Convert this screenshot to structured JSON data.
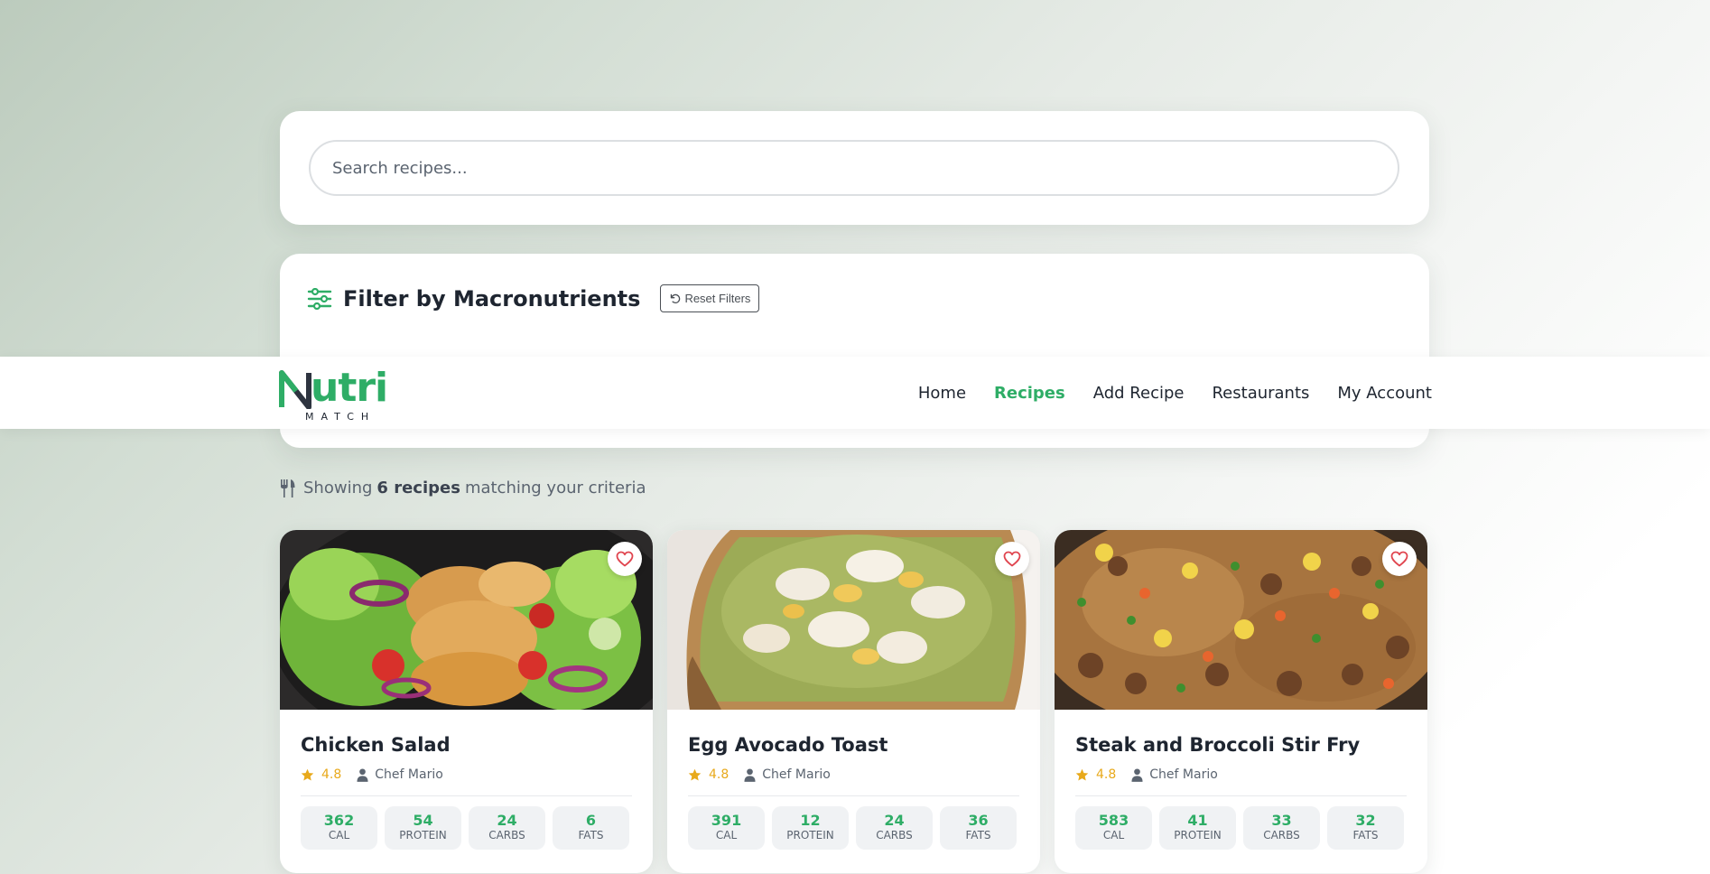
{
  "search": {
    "placeholder": "Search recipes..."
  },
  "filter": {
    "title": "Filter by Macronutrients",
    "reset_label": "Reset Filters"
  },
  "nav": {
    "logo_word": "utri",
    "logo_sub": "MATCH",
    "links": [
      {
        "label": "Home",
        "active": false
      },
      {
        "label": "Recipes",
        "active": true
      },
      {
        "label": "Add Recipe",
        "active": false
      },
      {
        "label": "Restaurants",
        "active": false
      },
      {
        "label": "My Account",
        "active": false
      }
    ]
  },
  "results": {
    "prefix": "Showing",
    "count": "6 recipes",
    "suffix": "matching your criteria"
  },
  "recipes": [
    {
      "title": "Chicken Salad",
      "rating": "4.8",
      "chef": "Chef Mario",
      "macros": [
        {
          "value": "362",
          "label": "CAL"
        },
        {
          "value": "54",
          "label": "PROTEIN"
        },
        {
          "value": "24",
          "label": "CARBS"
        },
        {
          "value": "6",
          "label": "FATS"
        }
      ]
    },
    {
      "title": "Egg Avocado Toast",
      "rating": "4.8",
      "chef": "Chef Mario",
      "macros": [
        {
          "value": "391",
          "label": "CAL"
        },
        {
          "value": "12",
          "label": "PROTEIN"
        },
        {
          "value": "24",
          "label": "CARBS"
        },
        {
          "value": "36",
          "label": "FATS"
        }
      ]
    },
    {
      "title": "Steak and Broccoli Stir Fry",
      "rating": "4.8",
      "chef": "Chef Mario",
      "macros": [
        {
          "value": "583",
          "label": "CAL"
        },
        {
          "value": "41",
          "label": "PROTEIN"
        },
        {
          "value": "33",
          "label": "CARBS"
        },
        {
          "value": "32",
          "label": "FATS"
        }
      ]
    }
  ],
  "colors": {
    "accent": "#2ead66",
    "rating": "#e8a91b",
    "heart": "#e0454f"
  }
}
